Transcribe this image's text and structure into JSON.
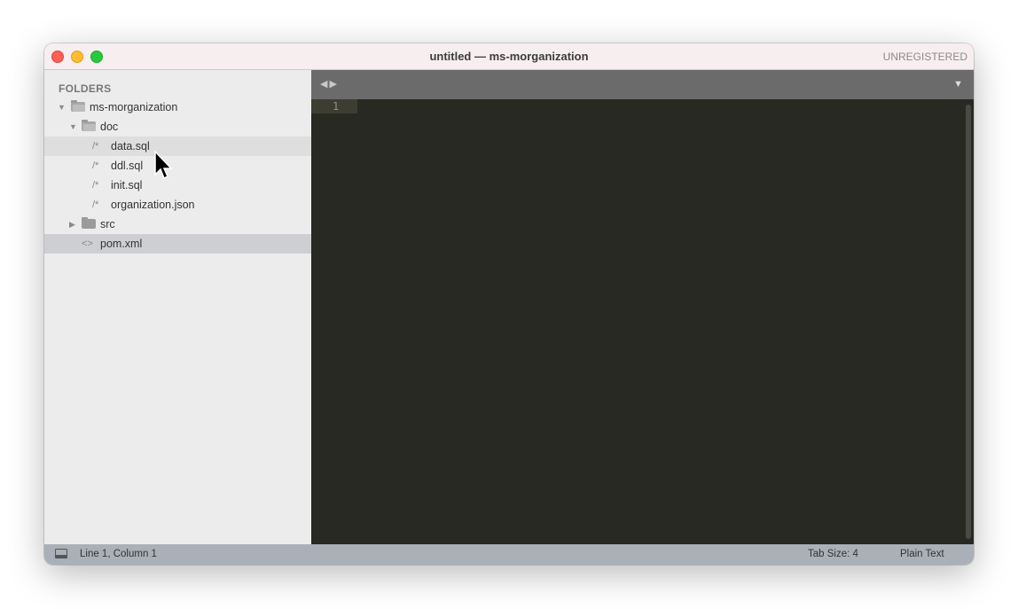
{
  "window": {
    "title": "untitled — ms-morganization",
    "registration": "UNREGISTERED"
  },
  "sidebar": {
    "header": "FOLDERS",
    "items": [
      {
        "label": "ms-morganization",
        "type": "folder-open",
        "icon": "/*"
      },
      {
        "label": "doc",
        "type": "folder-open"
      },
      {
        "label": "data.sql",
        "icon": "/*"
      },
      {
        "label": "ddl.sql",
        "icon": "/*"
      },
      {
        "label": "init.sql",
        "icon": "/*"
      },
      {
        "label": "organization.json",
        "icon": "/*"
      },
      {
        "label": "src",
        "type": "folder-closed"
      },
      {
        "label": "pom.xml",
        "icon": "<>"
      }
    ]
  },
  "editor": {
    "line_numbers": [
      "1"
    ]
  },
  "status": {
    "position": "Line 1, Column 1",
    "tab_size": "Tab Size: 4",
    "syntax": "Plain Text"
  },
  "colors": {
    "editor_bg": "#282923",
    "tabbar_bg": "#6b6b6b",
    "status_bg": "#a9b0b8",
    "sidebar_bg": "#ececec"
  }
}
